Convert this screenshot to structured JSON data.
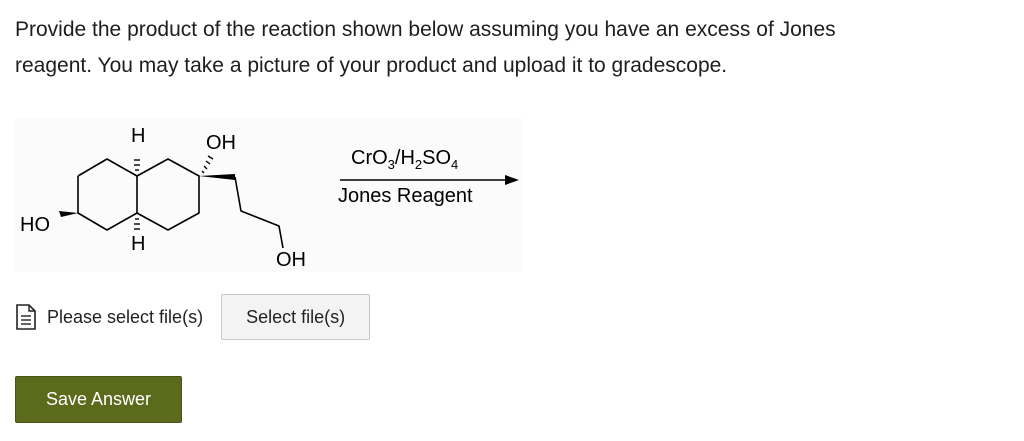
{
  "question": {
    "line1": "Provide the product of the reaction shown below assuming you have an excess of Jones",
    "line2": "reagent. You may take a picture of your product and upload it to gradescope."
  },
  "reaction": {
    "labels": {
      "h_top": "H",
      "h_bottom": "H",
      "oh_top": "OH",
      "oh_bottom": "OH",
      "ho_left": "HO"
    },
    "reagent_top": {
      "cr": "CrO",
      "cr_sub": "3",
      "slash_h": "/H",
      "h_sub": "2",
      "so": "SO",
      "so_sub": "4"
    },
    "reagent_bottom": "Jones Reagent"
  },
  "upload": {
    "status": "Please select file(s)",
    "button": "Select file(s)",
    "icon": "document-icon"
  },
  "save_button": "Save Answer",
  "colors": {
    "save_button_bg": "#5b6a1b",
    "text": "#222222"
  }
}
